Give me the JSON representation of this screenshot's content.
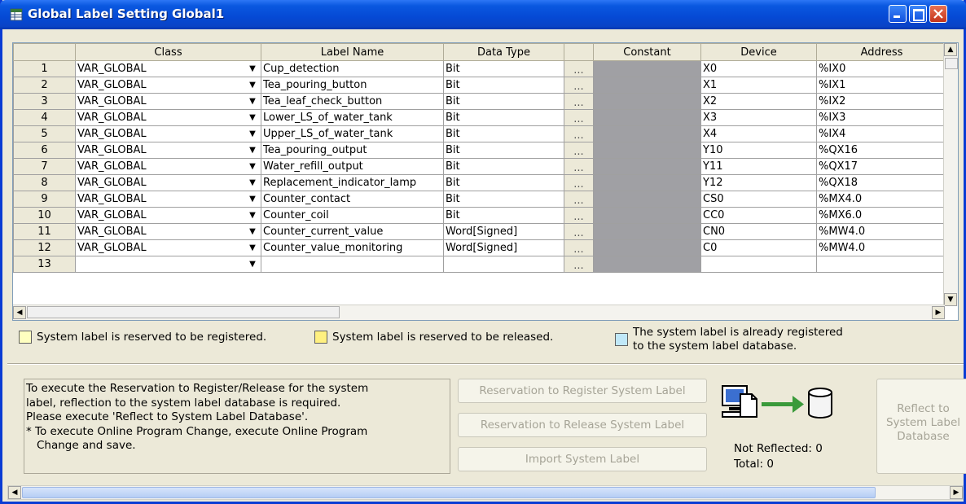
{
  "window": {
    "title": "Global Label Setting Global1",
    "title_color": "#0549d4"
  },
  "columns": [
    "Class",
    "Label Name",
    "Data Type",
    "Constant",
    "Device",
    "Address"
  ],
  "dots_label": "...",
  "rows": [
    {
      "num": "1",
      "class": "VAR_GLOBAL",
      "label": "Cup_detection",
      "type": "Bit",
      "device": "X0",
      "address": "%IX0"
    },
    {
      "num": "2",
      "class": "VAR_GLOBAL",
      "label": "Tea_pouring_button",
      "type": "Bit",
      "device": "X1",
      "address": "%IX1"
    },
    {
      "num": "3",
      "class": "VAR_GLOBAL",
      "label": "Tea_leaf_check_button",
      "type": "Bit",
      "device": "X2",
      "address": "%IX2"
    },
    {
      "num": "4",
      "class": "VAR_GLOBAL",
      "label": "Lower_LS_of_water_tank",
      "type": "Bit",
      "device": "X3",
      "address": "%IX3"
    },
    {
      "num": "5",
      "class": "VAR_GLOBAL",
      "label": "Upper_LS_of_water_tank",
      "type": "Bit",
      "device": "X4",
      "address": "%IX4"
    },
    {
      "num": "6",
      "class": "VAR_GLOBAL",
      "label": "Tea_pouring_output",
      "type": "Bit",
      "device": "Y10",
      "address": "%QX16"
    },
    {
      "num": "7",
      "class": "VAR_GLOBAL",
      "label": "Water_refill_output",
      "type": "Bit",
      "device": "Y11",
      "address": "%QX17"
    },
    {
      "num": "8",
      "class": "VAR_GLOBAL",
      "label": "Replacement_indicator_lamp",
      "type": "Bit",
      "device": "Y12",
      "address": "%QX18"
    },
    {
      "num": "9",
      "class": "VAR_GLOBAL",
      "label": "Counter_contact",
      "type": "Bit",
      "device": "CS0",
      "address": "%MX4.0"
    },
    {
      "num": "10",
      "class": "VAR_GLOBAL",
      "label": "Counter_coil",
      "type": "Bit",
      "device": "CC0",
      "address": "%MX6.0"
    },
    {
      "num": "11",
      "class": "VAR_GLOBAL",
      "label": "Counter_current_value",
      "type": "Word[Signed]",
      "device": "CN0",
      "address": "%MW4.0"
    },
    {
      "num": "12",
      "class": "VAR_GLOBAL",
      "label": "Counter_value_monitoring",
      "type": "Word[Signed]",
      "device": "C0",
      "address": "%MW4.0"
    },
    {
      "num": "13",
      "class": "",
      "label": "",
      "type": "",
      "device": "",
      "address": ""
    }
  ],
  "legend": {
    "reserved_register": "System label is reserved to be registered.",
    "reserved_release": "System label is reserved to be released.",
    "registered_line1": "The system label is already registered",
    "registered_line2": "to the system label database.",
    "register_color": "#ffffc0",
    "release_color": "#fff080",
    "registered_color": "#c0e8f8"
  },
  "info": {
    "line1": "To execute the Reservation to Register/Release for the system",
    "line2": "label, reflection to the system label database is required.",
    "line3": "Please execute 'Reflect to System Label Database'.",
    "line4": "* To execute Online Program Change, execute Online Program",
    "line5": "  Change and save."
  },
  "buttons": {
    "register": "Reservation to Register System Label",
    "release": "Reservation to Release System Label",
    "import": "Import System Label",
    "reflect_line1": "Reflect to",
    "reflect_line2": "System Label",
    "reflect_line3": "Database"
  },
  "status": {
    "not_reflected": "Not Reflected: 0",
    "total": "Total: 0"
  }
}
